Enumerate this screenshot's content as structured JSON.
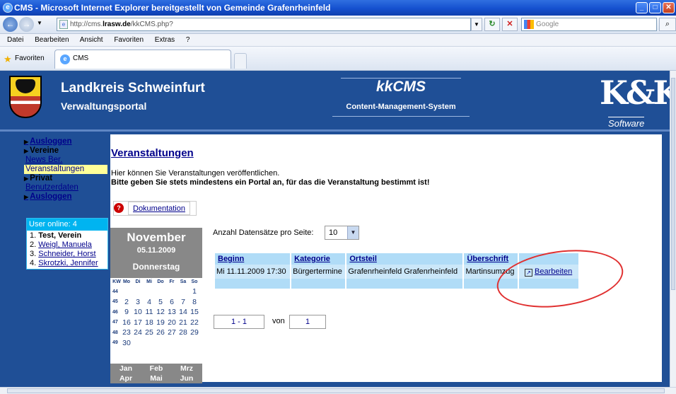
{
  "window": {
    "title": "CMS - Microsoft Internet Explorer bereitgestellt von Gemeinde Grafenrheinfeld"
  },
  "address": {
    "url_prefix": "http://cms.",
    "url_bold": "lrasw.de",
    "url_rest": "/kkCMS.php?"
  },
  "search": {
    "placeholder": "Google"
  },
  "menu": [
    "Datei",
    "Bearbeiten",
    "Ansicht",
    "Favoriten",
    "Extras",
    "?"
  ],
  "favorites": {
    "label": "Favoriten",
    "tab_label": "CMS"
  },
  "header": {
    "title": "Landkreis Schweinfurt",
    "subtitle": "Verwaltungsportal",
    "cms_title": "kkCMS",
    "cms_subtitle": "Content-Management-System",
    "logo_text": "K&K",
    "logo_sub": "Software"
  },
  "sidebar": {
    "items": [
      {
        "label": "Ausloggen"
      },
      {
        "label": "Vereine"
      },
      {
        "label": "News Ber."
      },
      {
        "label": "Veranstaltungen"
      },
      {
        "label": "Privat"
      },
      {
        "label": "Benutzerdaten"
      },
      {
        "label": "Ausloggen"
      }
    ]
  },
  "users": {
    "header": "User online: 4",
    "list": [
      {
        "num": "1.",
        "name": "Test, Verein"
      },
      {
        "num": "2.",
        "name": "Weigl, Manuela"
      },
      {
        "num": "3.",
        "name": "Schneider, Horst"
      },
      {
        "num": "4.",
        "name": "Skrotzki, Jennifer"
      }
    ]
  },
  "calendar": {
    "month": "November",
    "date": "05.11.2009",
    "day": "Donnerstag",
    "headers": [
      "KW",
      "Mo",
      "Di",
      "Mi",
      "Do",
      "Fr",
      "Sa",
      "So"
    ],
    "weeks": [
      {
        "kw": "44",
        "days": [
          "",
          "",
          "",
          "",
          "",
          "",
          "1"
        ]
      },
      {
        "kw": "45",
        "days": [
          "2",
          "3",
          "4",
          "5",
          "6",
          "7",
          "8"
        ]
      },
      {
        "kw": "46",
        "days": [
          "9",
          "10",
          "11",
          "12",
          "13",
          "14",
          "15"
        ]
      },
      {
        "kw": "47",
        "days": [
          "16",
          "17",
          "18",
          "19",
          "20",
          "21",
          "22"
        ]
      },
      {
        "kw": "48",
        "days": [
          "23",
          "24",
          "25",
          "26",
          "27",
          "28",
          "29"
        ]
      },
      {
        "kw": "49",
        "days": [
          "30",
          "",
          "",
          "",
          "",
          "",
          ""
        ]
      }
    ],
    "months": [
      "Jan",
      "Feb",
      "Mrz",
      "Apr",
      "Mai",
      "Jun"
    ]
  },
  "main": {
    "title": "Veranstaltungen",
    "info1": "Hier können Sie Veranstaltungen veröffentlichen.",
    "info2": "Bitte geben Sie stets mindestens ein Portal an, für das die Veranstaltung bestimmt ist!",
    "doc_label": "Dokumentation",
    "perpage_label": "Anzahl Datensätze pro Seite:",
    "perpage_value": "10",
    "table": {
      "headers": [
        "Beginn",
        "Kategorie",
        "Ortsteil",
        "Überschrift"
      ],
      "row": {
        "beginn": "Mi 11.11.2009 17:30",
        "kategorie": "Bürgertermine",
        "ortsteil": "Grafenrheinfeld Grafenrheinfeld",
        "ueberschrift": "Martinsumzug",
        "action": "Bearbeiten"
      }
    },
    "pager": {
      "range": "1 - 1",
      "of": "von",
      "total": "1"
    }
  }
}
